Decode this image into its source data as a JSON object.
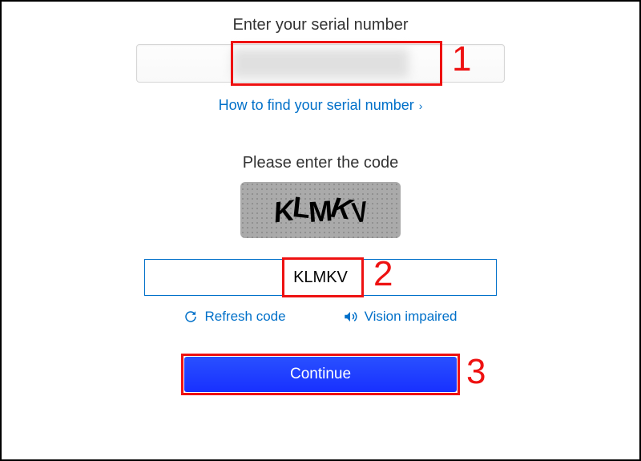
{
  "serial": {
    "label": "Enter your serial number",
    "value": "",
    "help_link": "How to find your serial number"
  },
  "captcha": {
    "label": "Please enter the code",
    "image_text": "KLMKV",
    "input_value": "KLMKV",
    "refresh_label": "Refresh code",
    "vision_label": "Vision impaired"
  },
  "continue_label": "Continue",
  "annotations": {
    "n1": "1",
    "n2": "2",
    "n3": "3"
  }
}
